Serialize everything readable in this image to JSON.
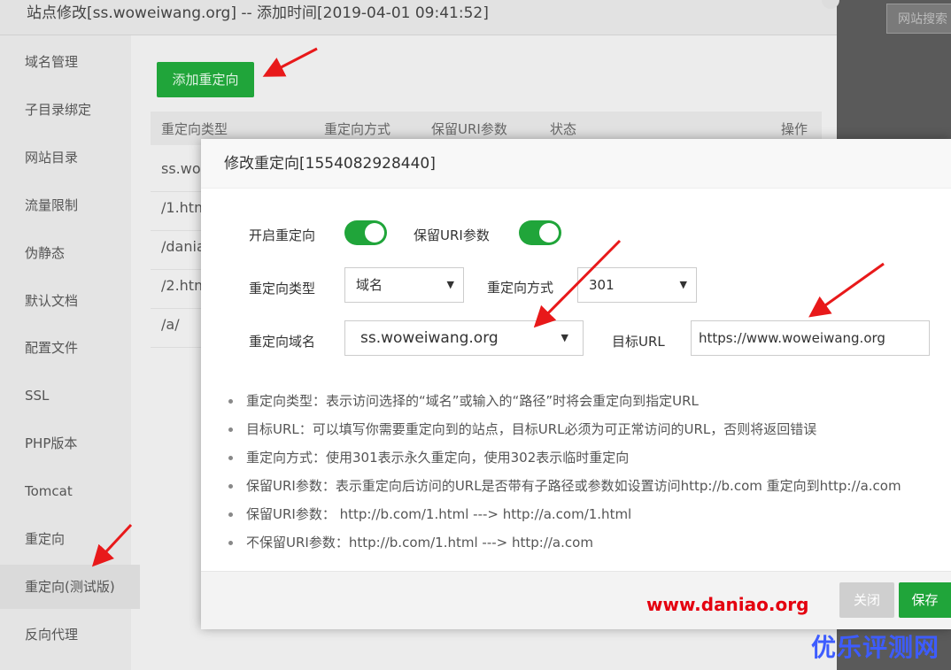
{
  "window": {
    "title": "站点修改[ss.woweiwang.org] -- 添加时间[2019-04-01 09:41:52]",
    "search_placeholder": "网站搜索"
  },
  "sidebar": {
    "items": [
      {
        "label": "域名管理"
      },
      {
        "label": "子目录绑定"
      },
      {
        "label": "网站目录"
      },
      {
        "label": "流量限制"
      },
      {
        "label": "伪静态"
      },
      {
        "label": "默认文档"
      },
      {
        "label": "配置文件"
      },
      {
        "label": "SSL"
      },
      {
        "label": "PHP版本"
      },
      {
        "label": "Tomcat"
      },
      {
        "label": "重定向"
      },
      {
        "label": "重定向(测试版)"
      },
      {
        "label": "反向代理"
      }
    ],
    "active_index": 11
  },
  "main": {
    "add_button": "添加重定向",
    "table": {
      "headers": [
        "重定向类型",
        "重定向方式",
        "保留URI参数",
        "状态",
        "操作"
      ],
      "rows": [
        "ss.wow",
        "/1.htm",
        "/dania",
        "/2.htm",
        "/a/"
      ]
    }
  },
  "modal": {
    "title": "修改重定向[1554082928440]",
    "enable_label": "开启重定向",
    "keep_uri_label": "保留URI参数",
    "type_label": "重定向类型",
    "type_value": "域名",
    "method_label": "重定向方式",
    "method_value": "301",
    "domain_label": "重定向域名",
    "domain_value": "ss.woweiwang.org",
    "target_label": "目标URL",
    "target_value": "https://www.woweiwang.org",
    "tips": [
      "重定向类型：表示访问选择的“域名”或输入的“路径”时将会重定向到指定URL",
      "目标URL：可以填写你需要重定向到的站点，目标URL必须为可正常访问的URL，否则将返回错误",
      "重定向方式：使用301表示永久重定向，使用302表示临时重定向",
      "保留URI参数：表示重定向后访问的URL是否带有子路径或参数如设置访问http://b.com 重定向到http://a.com",
      "保留URI参数： http://b.com/1.html ---> http://a.com/1.html",
      "不保留URI参数：http://b.com/1.html ---> http://a.com"
    ],
    "close_button": "关闭",
    "save_button": "保存"
  },
  "watermarks": {
    "site": "www.daniao.org",
    "brand": "优乐评测网"
  },
  "colors": {
    "accent_green": "#20a53a",
    "arrow_red": "#e8191a",
    "watermark_blue": "#3d5cff"
  }
}
